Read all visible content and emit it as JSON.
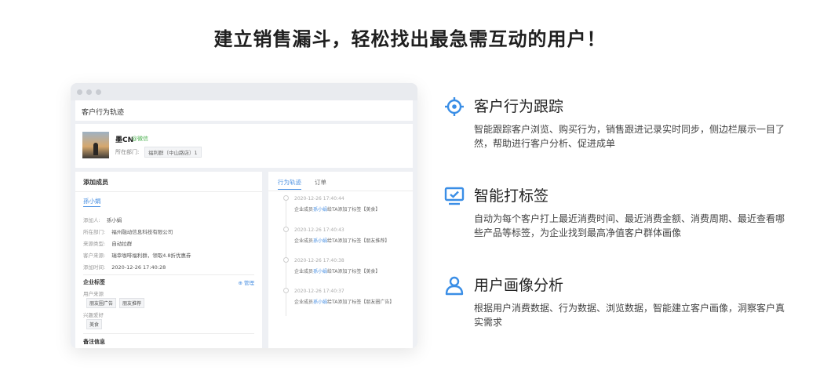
{
  "headline": "建立销售漏斗，轻松找出最急需互动的用户！",
  "colors": {
    "accent": "#4a90e2",
    "icon": "#3a8ee6",
    "wechat": "#4cb050"
  },
  "mock": {
    "section_title": "客户行为轨迹",
    "profile": {
      "name": "墨CN",
      "wechat_tag": "@微信",
      "dept_label": "所在部门:",
      "dept_value": "福利群（中山路店）1"
    },
    "left": {
      "title": "添加成员",
      "tab": "孫小娟",
      "rows": [
        {
          "label": "添加人:",
          "value": "孫小娟"
        },
        {
          "label": "所在部门:",
          "value": "福州融动信息科技有限公司"
        },
        {
          "label": "来源类型:",
          "value": "自动拉群"
        },
        {
          "label": "客户来源:",
          "value": "瑞幸咖啡福利群，领取4.8折优惠券"
        },
        {
          "label": "添加时间:",
          "value": "2020-12-26 17:40:28"
        }
      ],
      "tags_title": "企业标签",
      "manage": "⊕ 管理",
      "user_source_label": "用户来源",
      "user_source_chips": [
        "朋友圈广告",
        "朋友推荐"
      ],
      "interest_label": "兴趣爱好",
      "interest_chips": [
        "美食"
      ],
      "notes_title": "备注信息"
    },
    "right": {
      "tab_active": "行为轨迹",
      "tab_normal": "订单",
      "events": [
        {
          "time": "2020-12-26 17:40:44",
          "prefix": "企业成员",
          "name": "孫小娟",
          "suffix": "给TA添加了标签【美食】"
        },
        {
          "time": "2020-12-26 17:40:43",
          "prefix": "企业成员",
          "name": "孫小娟",
          "suffix": "给TA添加了标签【朋友推荐】"
        },
        {
          "time": "2020-12-26 17:40:38",
          "prefix": "企业成员",
          "name": "孫小娟",
          "suffix": "给TA添加了标签【美食】"
        },
        {
          "time": "2020-12-26 17:40:37",
          "prefix": "企业成员",
          "name": "孫小娟",
          "suffix": "给TA添加了标签【朋友圈广告】"
        }
      ]
    }
  },
  "features": [
    {
      "icon": "crosshair-icon",
      "title": "客户行为跟踪",
      "desc": "智能跟踪客户浏览、购买行为，销售跟进记录实时同步，侧边栏展示一目了然，帮助进行客户分析、促进成单"
    },
    {
      "icon": "monitor-check-icon",
      "title": "智能打标签",
      "desc": "自动为每个客户打上最近消费时间、最近消费金额、消费周期、最近查看哪些产品等标签，为企业找到最高净值客户群体画像"
    },
    {
      "icon": "user-icon",
      "title": "用户画像分析",
      "desc": "根据用户消费数据、行为数据、浏览数据，智能建立客户画像，洞察客户真实需求"
    }
  ]
}
